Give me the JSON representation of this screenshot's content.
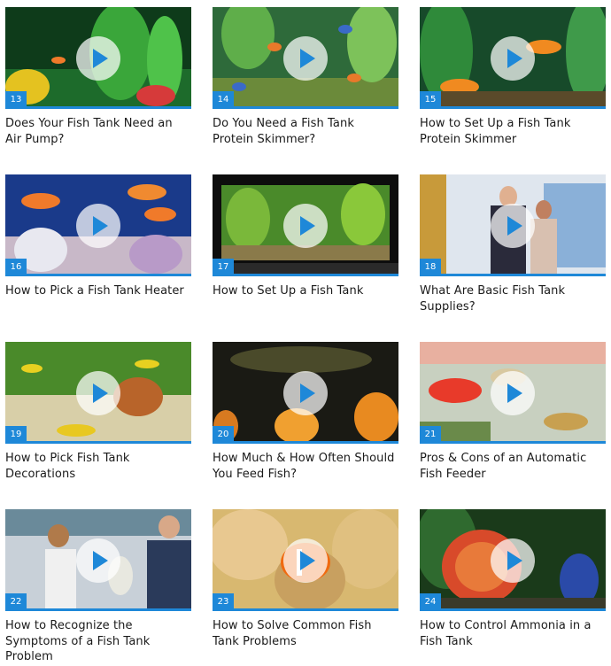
{
  "videos": [
    {
      "number": "13",
      "title": "Does Your Fish Tank Need an Air Pump?",
      "scene": "aquarium-plants",
      "icon": "play-icon"
    },
    {
      "number": "14",
      "title": "Do You Need a Fish Tank Protein Skimmer?",
      "scene": "aquarium-fish",
      "icon": "play-icon"
    },
    {
      "number": "15",
      "title": "How to Set Up a Fish Tank Protein Skimmer",
      "scene": "aquarium-goldfish",
      "icon": "play-icon"
    },
    {
      "number": "16",
      "title": "How to Pick a Fish Tank Heater",
      "scene": "aquarium-coral",
      "icon": "play-icon"
    },
    {
      "number": "17",
      "title": "How to Set Up a Fish Tank",
      "scene": "aquarium-tank",
      "icon": "play-icon"
    },
    {
      "number": "18",
      "title": "What Are Basic Fish Tank Supplies?",
      "scene": "pet-store",
      "icon": "play-icon"
    },
    {
      "number": "19",
      "title": "How to Pick Fish Tank Decorations",
      "scene": "aquarium-gravel",
      "icon": "play-icon"
    },
    {
      "number": "20",
      "title": "How Much & How Often Should You Feed Fish?",
      "scene": "goldfish-feeding",
      "icon": "play-icon"
    },
    {
      "number": "21",
      "title": "Pros & Cons of an Automatic Fish Feeder",
      "scene": "guppies",
      "icon": "play-icon"
    },
    {
      "number": "22",
      "title": "How to Recognize the Symptoms of a Fish Tank Problem",
      "scene": "store-people",
      "icon": "play-icon"
    },
    {
      "number": "23",
      "title": "How to Solve Common Fish Tank Problems",
      "scene": "clownfish",
      "icon": "play-icon"
    },
    {
      "number": "24",
      "title": "How to Control Ammonia in a Fish Tank",
      "scene": "discus",
      "icon": "play-icon"
    }
  ],
  "colors": {
    "accent": "#1e88d8",
    "text": "#1a1a1a"
  }
}
